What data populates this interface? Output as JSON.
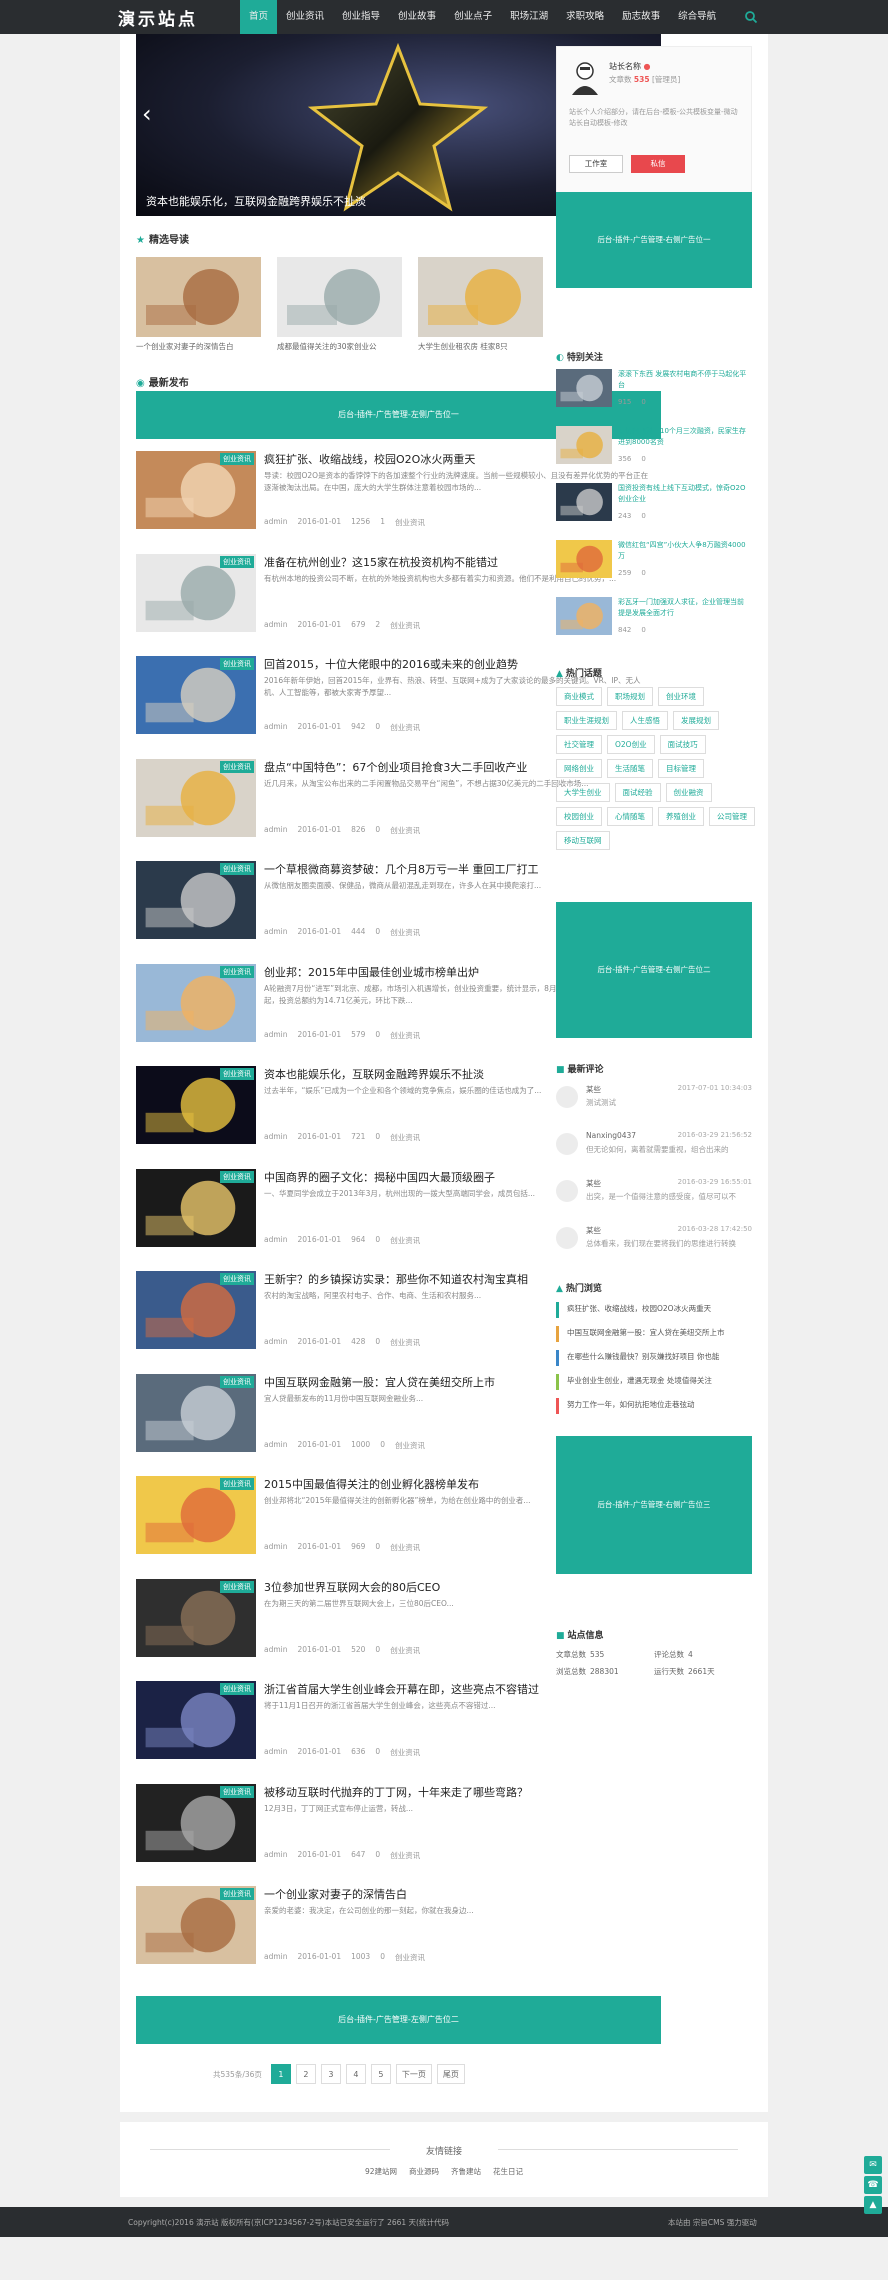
{
  "header": {
    "logo": "演示站点",
    "nav": [
      "首页",
      "创业资讯",
      "创业指导",
      "创业故事",
      "创业点子",
      "职场江湖",
      "求职攻略",
      "励志故事",
      "综合导航"
    ],
    "active": 0
  },
  "slider": {
    "caption": "资本也能娱乐化，互联网金融跨界娱乐不扯淡",
    "dots": 5,
    "active_dot": 0
  },
  "featured": {
    "heading": "精选导读",
    "items": [
      "一个创业家对妻子的深情告白",
      "成都最值得关注的30家创业公",
      "大学生创业租农房 桂家8只"
    ]
  },
  "latest": {
    "heading": "最新发布",
    "ad1": "后台-插件-广告管理-左侧广告位一",
    "ad2": "后台-插件-广告管理-左侧广告位二",
    "articles": [
      {
        "badge": "创业资讯",
        "title": "疯狂扩张、收缩战线，校园O2O冰火两重天",
        "excerpt": "导读：校园O2O是资本的香饽饽下的各加速整个行业的洗牌速度。当前一些规模较小、且没有差异化优势的平台正在逐渐被淘汰出局。在中国，庞大的大学生群体注意着校园市场的...",
        "date": "2016-01-01",
        "views": "1256",
        "comments": "1",
        "cat": "创业资讯"
      },
      {
        "badge": "创业资讯",
        "title": "准备在杭州创业？这15家在杭投资机构不能错过",
        "excerpt": "有杭州本地的投资公司不断，在杭的外地投资机构也大多都有着实力和资源。他们不是利用自己的优势，...",
        "date": "2016-01-01",
        "views": "679",
        "comments": "2",
        "cat": "创业资讯"
      },
      {
        "badge": "创业资讯",
        "title": "回首2015，十位大佬眼中的2016或未来的创业趋势",
        "excerpt": "2016年新年伊始，回首2015年，业界有、热浪、转型、互联网+成为了大家谈论的最多的关键词。VR、IP、无人机、人工智能等，都被大家寄予厚望...",
        "date": "2016-01-01",
        "views": "942",
        "comments": "0",
        "cat": "创业资讯"
      },
      {
        "badge": "创业资讯",
        "title": "盘点“中国特色”：67个创业项目抢食3大二手回收产业",
        "excerpt": "近几月来，从淘宝公布出来的二手闲置物品交易平台“闲鱼”，不想占据30亿美元的二手回收市场...",
        "date": "2016-01-01",
        "views": "826",
        "comments": "0",
        "cat": "创业资讯"
      },
      {
        "badge": "创业资讯",
        "title": "一个草根微商募资梦破：几个月8万亏一半 重回工厂打工",
        "excerpt": "从微信朋友圈卖面膜、保健品，微商从最初混乱走到现在，许多人在其中摸爬滚打...",
        "date": "2016-01-01",
        "views": "444",
        "comments": "0",
        "cat": "创业资讯"
      },
      {
        "badge": "创业资讯",
        "title": "创业邦：2015年中国最佳创业城市榜单出炉",
        "excerpt": "A轮融资7月份“进军”到北京、成都，市场引入机遇增长，创业投资重要，统计显示，8月VC市场披露的案例为106起，投资总额约为14.71亿美元，环比下跌...",
        "date": "2016-01-01",
        "views": "579",
        "comments": "0",
        "cat": "创业资讯"
      },
      {
        "badge": "创业资讯",
        "title": "资本也能娱乐化，互联网金融跨界娱乐不扯淡",
        "excerpt": "过去半年，“娱乐”已成为一个企业和各个领域的竞争焦点，娱乐圈的佳话也成为了...",
        "date": "2016-01-01",
        "views": "721",
        "comments": "0",
        "cat": "创业资讯"
      },
      {
        "badge": "创业资讯",
        "title": "中国商界的圈子文化：揭秘中国四大最顶级圈子",
        "excerpt": "一、华夏同学会成立于2013年3月，杭州出现的一拨大型高端同学会，成员包括...",
        "date": "2016-01-01",
        "views": "964",
        "comments": "0",
        "cat": "创业资讯"
      },
      {
        "badge": "创业资讯",
        "title": "王新宇？的乡镇探访实录：那些你不知道农村淘宝真相",
        "excerpt": "农村的淘宝战略，阿里农村电子、合作、电商、生活和农村服务...",
        "date": "2016-01-01",
        "views": "428",
        "comments": "0",
        "cat": "创业资讯"
      },
      {
        "badge": "创业资讯",
        "title": "中国互联网金融第一股：宜人贷在美纽交所上市",
        "excerpt": "宜人贷最新发布的11月份中国互联网金融业务...",
        "date": "2016-01-01",
        "views": "1000",
        "comments": "0",
        "cat": "创业资讯"
      },
      {
        "badge": "创业资讯",
        "title": "2015中国最值得关注的创业孵化器榜单发布",
        "excerpt": "创业邦将北“2015年最值得关注的创新孵化器”榜单，为给在创业路中的创业者...",
        "date": "2016-01-01",
        "views": "969",
        "comments": "0",
        "cat": "创业资讯"
      },
      {
        "badge": "创业资讯",
        "title": "3位参加世界互联网大会的80后CEO",
        "excerpt": "在为期三天的第二届世界互联网大会上，三位80后CEO...",
        "date": "2016-01-01",
        "views": "520",
        "comments": "0",
        "cat": "创业资讯"
      },
      {
        "badge": "创业资讯",
        "title": "浙江省首届大学生创业峰会开幕在即，这些亮点不容错过",
        "excerpt": "将于11月1日召开的浙江省首届大学生创业峰会，这些亮点不容错过...",
        "date": "2016-01-01",
        "views": "636",
        "comments": "0",
        "cat": "创业资讯"
      },
      {
        "badge": "创业资讯",
        "title": "被移动互联时代抛弃的丁丁网，十年来走了哪些弯路？",
        "excerpt": "12月3日，丁丁网正式宣布停止运营，转战...",
        "date": "2016-01-01",
        "views": "647",
        "comments": "0",
        "cat": "创业资讯"
      },
      {
        "badge": "创业资讯",
        "title": "一个创业家对妻子的深情告白",
        "excerpt": "亲爱的老婆：我决定，在公司创业的那一刻起，你就在我身边...",
        "date": "2016-01-01",
        "views": "1003",
        "comments": "0",
        "cat": "创业资讯"
      }
    ]
  },
  "pager": {
    "info": "共535条/36页",
    "pages": [
      "1",
      "2",
      "3",
      "4",
      "5",
      "下一页",
      "尾页"
    ],
    "active": 0
  },
  "sidebar": {
    "author": {
      "name": "站长名称",
      "label": "文章数",
      "count": "535",
      "level": "[管理员]",
      "desc": "站长个人介绍部分，请在后台-模板-公共模板变量-微动站长自动模板-修改",
      "btn1": "工作室",
      "btn2": "私信"
    },
    "ad1": "后台-插件-广告管理-右侧广告位一",
    "ad2": "后台-插件-广告管理-右侧广告位二",
    "ad3": "后台-插件-广告管理-右侧广告位三",
    "special_heading": "特别关注",
    "special": [
      {
        "title": "滚滚下东西 发展农村电商不停于马起化平台",
        "views": "915",
        "comments": "0"
      },
      {
        "title": "专访阿飞科：10个月三次融资，民家生存进到8000名资",
        "views": "356",
        "comments": "0"
      },
      {
        "title": "国资投资有线上线下互动模式，惊奇O2O创业企业",
        "views": "243",
        "comments": "0"
      },
      {
        "title": "微信红包“四宫”小伙大人争8万融资4000万",
        "views": "259",
        "comments": "0"
      },
      {
        "title": "彩瓦牙一门加强双人求征，企业管理当前提是发展全面才行",
        "views": "842",
        "comments": "0"
      }
    ],
    "tags_heading": "热门话题",
    "tags": [
      "商业模式",
      "职场规划",
      "创业环境",
      "职业生涯规划",
      "人生感悟",
      "发展规划",
      "社交管理",
      "O2O创业",
      "面试技巧",
      "网络创业",
      "生活随笔",
      "目标管理",
      "大学生创业",
      "面试经验",
      "创业融资",
      "校园创业",
      "心情随笔",
      "养殖创业",
      "公司管理",
      "移动互联网"
    ],
    "comments_heading": "最新评论",
    "comments": [
      {
        "name": "某些",
        "date": "2017-07-01 10:34:03",
        "text": "测试测试"
      },
      {
        "name": "Nanxing0437",
        "date": "2016-03-29 21:56:52",
        "text": "但无论如何，离着就需要重视，组合出来的"
      },
      {
        "name": "某些",
        "date": "2016-03-29 16:55:01",
        "text": "出突，是一个值得注意的感受度，值尽可以不"
      },
      {
        "name": "某些",
        "date": "2016-03-28 17:42:50",
        "text": "总体看来，我们现在要将我们的思维进行转换"
      }
    ],
    "hot_heading": "热门浏览",
    "hot": [
      "疯狂扩张、收缩战线，校园O2O冰火两重天",
      "中国互联网金融第一股：宜人贷在美纽交所上市",
      "在哪些什么赚钱最快？别灰嫌找好项目 你也能",
      "毕业创业生创业，遭遇无现金 处境值得关注",
      "努力工作一年，如何抗拒地位走巷弦动"
    ],
    "stats_heading": "站点信息",
    "stats": [
      [
        "文章总数",
        "535"
      ],
      [
        "评论总数",
        "4"
      ],
      [
        "浏览总数",
        "288301"
      ],
      [
        "运行天数",
        "2661天"
      ]
    ]
  },
  "footer": {
    "friend_title": "友情链接",
    "links": [
      "92建站网",
      "商业源码",
      "齐鲁建站",
      "花生日记"
    ],
    "copyright": "Copyright(c)2016 演示站 版权所有(京ICP1234567-2号)本站已安全运行了 2661 天(统计代码",
    "powered": "本站由 宗旨CMS 强力驱动"
  }
}
